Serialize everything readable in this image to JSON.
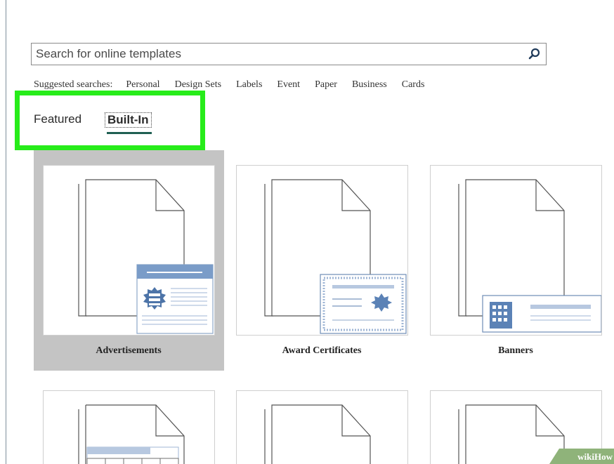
{
  "search": {
    "placeholder": "Search for online templates",
    "icon": "search-icon"
  },
  "suggested": {
    "label": "Suggested searches:",
    "items": [
      "Personal",
      "Design Sets",
      "Labels",
      "Event",
      "Paper",
      "Business",
      "Cards"
    ]
  },
  "tabs": [
    {
      "label": "Featured",
      "selected": false
    },
    {
      "label": "Built-In",
      "selected": true
    }
  ],
  "templates": [
    {
      "label": "Advertisements",
      "selected": true
    },
    {
      "label": "Award Certificates",
      "selected": false
    },
    {
      "label": "Banners",
      "selected": false
    },
    {
      "label": "",
      "selected": false
    },
    {
      "label": "",
      "selected": false
    },
    {
      "label": "",
      "selected": false
    }
  ],
  "colors": {
    "highlight": "#27ec1a",
    "accent_blue": "#7a9cc8",
    "tab_underline": "#1f5f52",
    "selected_card": "#c4c4c4"
  },
  "watermark": {
    "text": "wikiHow"
  }
}
